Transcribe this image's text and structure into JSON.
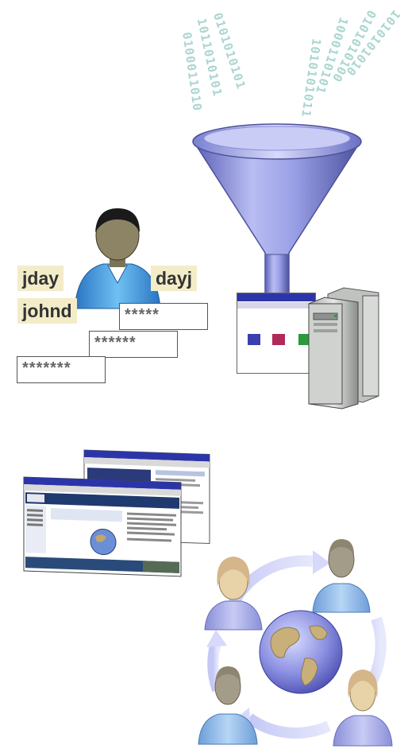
{
  "binary_streams": [
    {
      "text": "0100011010"
    },
    {
      "text": "1011010101"
    },
    {
      "text": "0101010101"
    },
    {
      "text": "1010101011"
    },
    {
      "text": "1000110101"
    },
    {
      "text": "0101010100"
    },
    {
      "text": "1010101010"
    }
  ],
  "usernames": {
    "primary": "jday",
    "alias": "dayj",
    "alternate": "johnd"
  },
  "passwords": [
    "*****",
    "******",
    "*******"
  ],
  "colors": {
    "funnel": "#8a8fd8",
    "binary": "#9ccfc8",
    "username_bg": "#f3ecc8",
    "shirt_blue": "#3a9ad9",
    "server_gray": "#c9ccc9",
    "globe": "#8a8ee0"
  },
  "icons": [
    "funnel-icon",
    "server-icon",
    "user-icon",
    "browser-window-icon",
    "globe-icon"
  ]
}
